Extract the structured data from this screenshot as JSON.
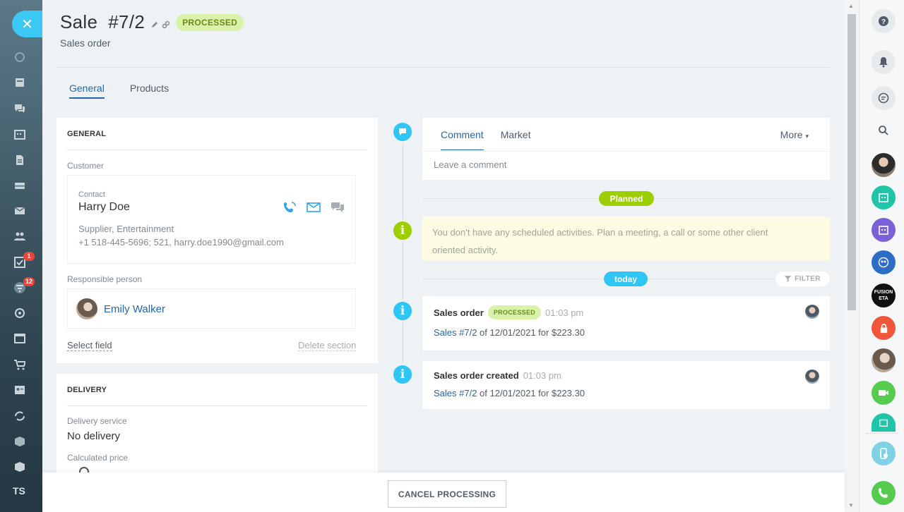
{
  "nav": {
    "close": "✕",
    "badges": {
      "tasks": "1",
      "crm": "12"
    },
    "user_initials": "TS"
  },
  "header": {
    "title": "Sale  #7/2",
    "status": "PROCESSED",
    "subtitle": "Sales order"
  },
  "tabs": [
    {
      "label": "General",
      "active": true
    },
    {
      "label": "Products",
      "active": false
    }
  ],
  "general": {
    "section_title": "GENERAL",
    "customer_label": "Customer",
    "contact_type": "Contact",
    "contact_name": "Harry Doe",
    "contact_company": "Supplier, Entertainment",
    "contact_details": "+1 518-445-5696; 521, harry.doe1990@gmail.com",
    "responsible_label": "Responsible person",
    "responsible_name": "Emily Walker",
    "select_field": "Select field",
    "delete_section": "Delete section"
  },
  "delivery": {
    "section_title": "DELIVERY",
    "service_label": "Delivery service",
    "service_value": "No delivery",
    "price_label": "Calculated price"
  },
  "timeline": {
    "comment_tabs": [
      "Comment",
      "Market"
    ],
    "more": "More",
    "comment_placeholder": "Leave a comment",
    "planned": "Planned",
    "planned_notice": "You don't have any scheduled activities. Plan a meeting, a call or some other client oriented activity.",
    "today": "today",
    "filter": "FILTER",
    "events": [
      {
        "title": "Sales order",
        "badge": "PROCESSED",
        "time": "01:03 pm",
        "link": "Sales #7/2",
        "desc": " of 12/01/2021 for $223.30"
      },
      {
        "title": "Sales order created",
        "badge": "",
        "time": "01:03 pm",
        "link": "Sales #7/2",
        "desc": " of 12/01/2021 for $223.30"
      }
    ]
  },
  "footer": {
    "cancel_button": "CANCEL PROCESSING"
  },
  "rightbar": {
    "avatar_fusion": "FUSION\nETA"
  },
  "colors": {
    "accent_blue": "#2067b0",
    "timeline_blue": "#2fc6f6",
    "timeline_green": "#9dcf00",
    "status_bg": "#d9f1a8"
  }
}
